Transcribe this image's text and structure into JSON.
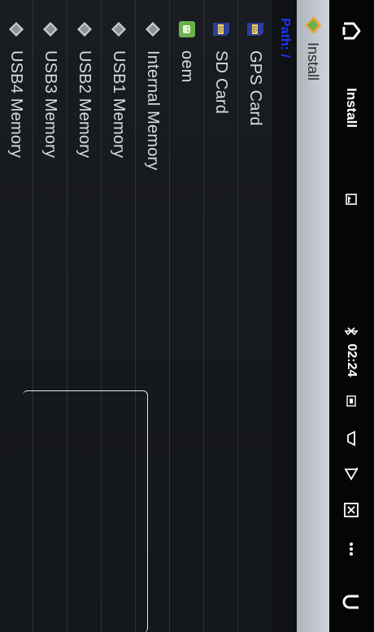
{
  "statusbar": {
    "title": "Install",
    "time": "02:24"
  },
  "titlebar": {
    "title": "Install"
  },
  "path": {
    "label": "Path: /"
  },
  "list": {
    "items": [
      {
        "label": "GPS Card",
        "icon": "sd-card-icon"
      },
      {
        "label": "SD Card",
        "icon": "sd-card-icon"
      },
      {
        "label": "oem",
        "icon": "android-app-icon"
      },
      {
        "label": "Internal Memory",
        "icon": "drive-icon"
      },
      {
        "label": "USB1 Memory",
        "icon": "drive-icon"
      },
      {
        "label": "USB2 Memory",
        "icon": "drive-icon"
      },
      {
        "label": "USB3 Memory",
        "icon": "drive-icon"
      },
      {
        "label": "USB4 Memory",
        "icon": "drive-icon"
      }
    ]
  },
  "colors": {
    "path_text": "#1a35ff",
    "list_text": "#d8dbdf"
  }
}
